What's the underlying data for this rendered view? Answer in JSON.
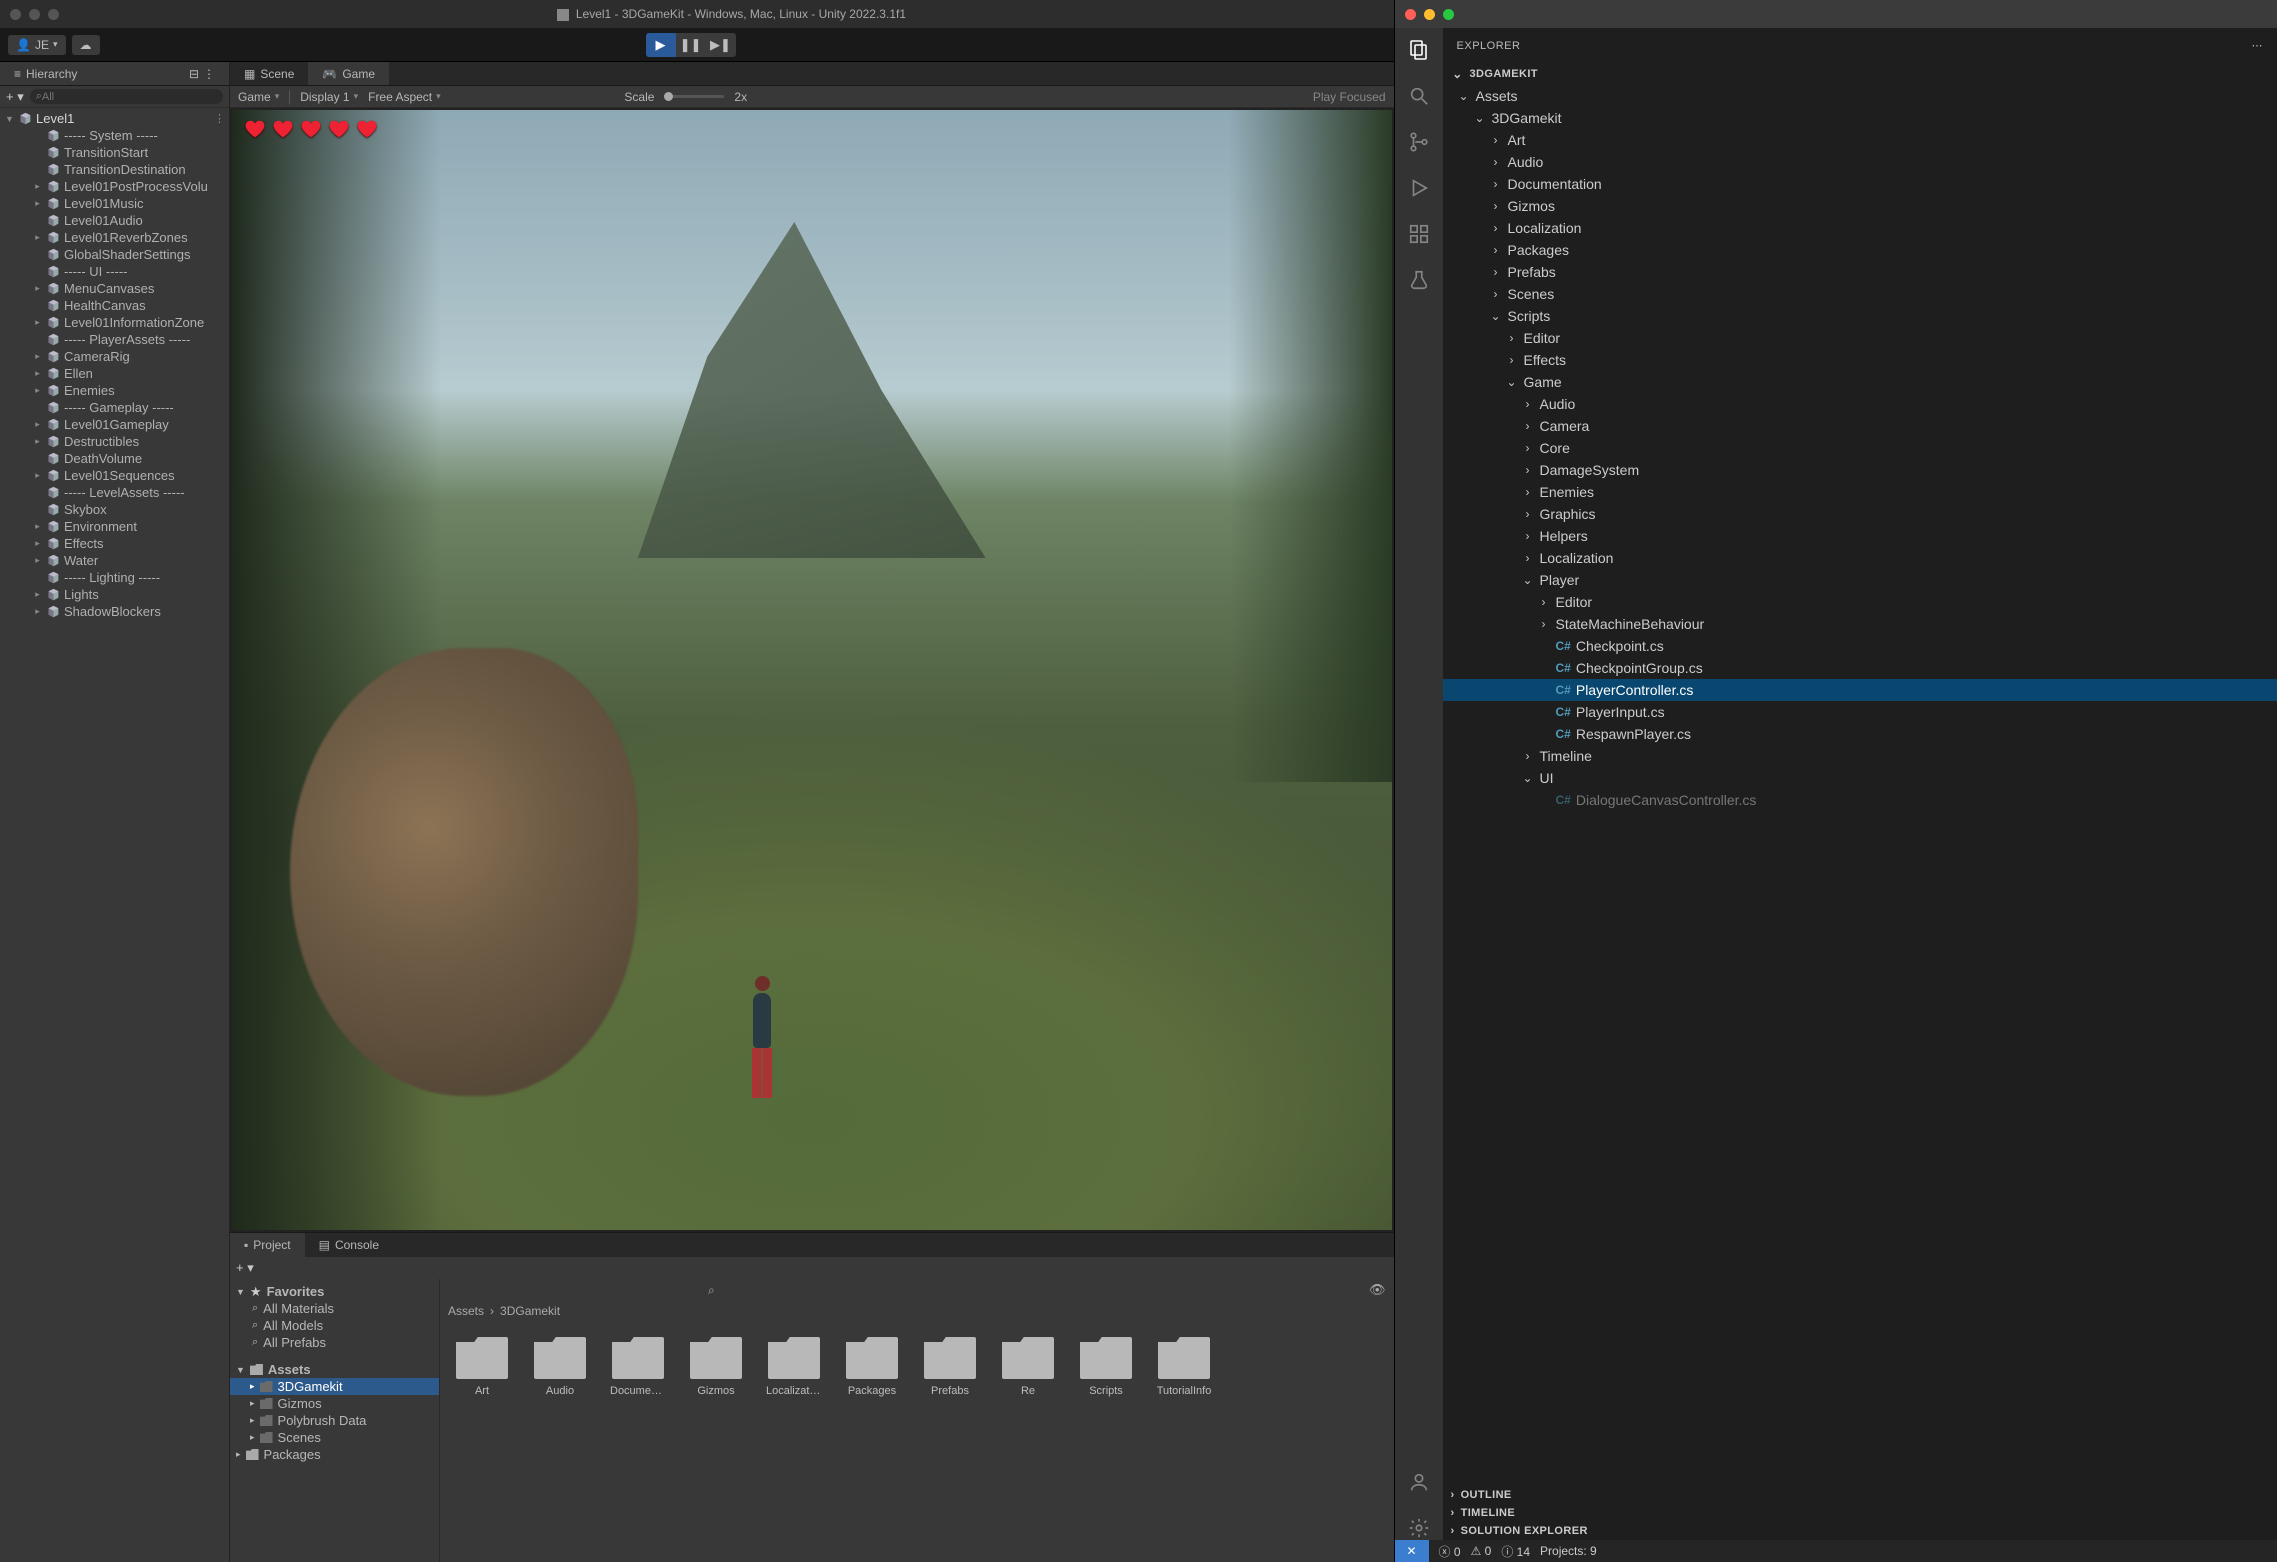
{
  "unity": {
    "title": "Level1 - 3DGameKit - Windows, Mac, Linux - Unity 2022.3.1f1",
    "account_initials": "JE",
    "hierarchy": {
      "tab": "Hierarchy",
      "search_placeholder": "All",
      "root": "Level1",
      "items": [
        {
          "l": "----- System -----",
          "i": 1,
          "e": ""
        },
        {
          "l": "TransitionStart",
          "i": 1,
          "e": ""
        },
        {
          "l": "TransitionDestination",
          "i": 1,
          "e": ""
        },
        {
          "l": "Level01PostProcessVolu",
          "i": 1,
          "e": ">"
        },
        {
          "l": "Level01Music",
          "i": 1,
          "e": ">"
        },
        {
          "l": "Level01Audio",
          "i": 1,
          "e": ""
        },
        {
          "l": "Level01ReverbZones",
          "i": 1,
          "e": ">"
        },
        {
          "l": "GlobalShaderSettings",
          "i": 1,
          "e": ""
        },
        {
          "l": "----- UI -----",
          "i": 1,
          "e": ""
        },
        {
          "l": "MenuCanvases",
          "i": 1,
          "e": ">"
        },
        {
          "l": "HealthCanvas",
          "i": 1,
          "e": ""
        },
        {
          "l": "Level01InformationZone",
          "i": 1,
          "e": ">"
        },
        {
          "l": "----- PlayerAssets -----",
          "i": 1,
          "e": ""
        },
        {
          "l": "CameraRig",
          "i": 1,
          "e": ">"
        },
        {
          "l": "Ellen",
          "i": 1,
          "e": ">"
        },
        {
          "l": "Enemies",
          "i": 1,
          "e": ">"
        },
        {
          "l": "----- Gameplay -----",
          "i": 1,
          "e": ""
        },
        {
          "l": "Level01Gameplay",
          "i": 1,
          "e": ">"
        },
        {
          "l": "Destructibles",
          "i": 1,
          "e": ">"
        },
        {
          "l": "DeathVolume",
          "i": 1,
          "e": ""
        },
        {
          "l": "Level01Sequences",
          "i": 1,
          "e": ">"
        },
        {
          "l": "----- LevelAssets -----",
          "i": 1,
          "e": ""
        },
        {
          "l": "Skybox",
          "i": 1,
          "e": ""
        },
        {
          "l": "Environment",
          "i": 1,
          "e": ">"
        },
        {
          "l": "Effects",
          "i": 1,
          "e": ">"
        },
        {
          "l": "Water",
          "i": 1,
          "e": ">"
        },
        {
          "l": "----- Lighting -----",
          "i": 1,
          "e": ""
        },
        {
          "l": "Lights",
          "i": 1,
          "e": ">"
        },
        {
          "l": "ShadowBlockers",
          "i": 1,
          "e": ">"
        }
      ]
    },
    "scene": {
      "tab_scene": "Scene",
      "tab_game": "Game",
      "drop_camera": "Game",
      "drop_display": "Display 1",
      "drop_aspect": "Free Aspect",
      "scale_label": "Scale",
      "scale_value": "2x",
      "play_focused": "Play Focused",
      "hearts_count": 5
    },
    "project": {
      "tab_project": "Project",
      "tab_console": "Console",
      "favorites_label": "Favorites",
      "fav_items": [
        "All Materials",
        "All Models",
        "All Prefabs"
      ],
      "assets_label": "Assets",
      "assets_tree": [
        "3DGamekit",
        "Gizmos",
        "Polybrush Data",
        "Scenes"
      ],
      "packages_label": "Packages",
      "breadcrumb": [
        "Assets",
        "3DGamekit"
      ],
      "folders": [
        "Art",
        "Audio",
        "Document…",
        "Gizmos",
        "Localization",
        "Packages",
        "Prefabs",
        "Re",
        "Scripts",
        "TutorialInfo"
      ]
    }
  },
  "vscode": {
    "explorer_label": "EXPLORER",
    "root": "3DGAMEKIT",
    "sections": [
      "OUTLINE",
      "TIMELINE",
      "SOLUTION EXPLORER"
    ],
    "status": {
      "errors": "0",
      "warnings": "0",
      "info": "14",
      "projects": "Projects: 9"
    },
    "tree": [
      {
        "d": 0,
        "ch": "v",
        "t": "folder",
        "l": "Assets"
      },
      {
        "d": 1,
        "ch": "v",
        "t": "folder",
        "l": "3DGamekit"
      },
      {
        "d": 2,
        "ch": ">",
        "t": "folder",
        "l": "Art"
      },
      {
        "d": 2,
        "ch": ">",
        "t": "folder",
        "l": "Audio"
      },
      {
        "d": 2,
        "ch": ">",
        "t": "folder",
        "l": "Documentation"
      },
      {
        "d": 2,
        "ch": ">",
        "t": "folder",
        "l": "Gizmos"
      },
      {
        "d": 2,
        "ch": ">",
        "t": "folder",
        "l": "Localization"
      },
      {
        "d": 2,
        "ch": ">",
        "t": "folder",
        "l": "Packages"
      },
      {
        "d": 2,
        "ch": ">",
        "t": "folder",
        "l": "Prefabs"
      },
      {
        "d": 2,
        "ch": ">",
        "t": "folder",
        "l": "Scenes"
      },
      {
        "d": 2,
        "ch": "v",
        "t": "folder",
        "l": "Scripts"
      },
      {
        "d": 3,
        "ch": ">",
        "t": "folder",
        "l": "Editor"
      },
      {
        "d": 3,
        "ch": ">",
        "t": "folder",
        "l": "Effects"
      },
      {
        "d": 3,
        "ch": "v",
        "t": "folder",
        "l": "Game"
      },
      {
        "d": 4,
        "ch": ">",
        "t": "folder",
        "l": "Audio"
      },
      {
        "d": 4,
        "ch": ">",
        "t": "folder",
        "l": "Camera"
      },
      {
        "d": 4,
        "ch": ">",
        "t": "folder",
        "l": "Core"
      },
      {
        "d": 4,
        "ch": ">",
        "t": "folder",
        "l": "DamageSystem"
      },
      {
        "d": 4,
        "ch": ">",
        "t": "folder",
        "l": "Enemies"
      },
      {
        "d": 4,
        "ch": ">",
        "t": "folder",
        "l": "Graphics"
      },
      {
        "d": 4,
        "ch": ">",
        "t": "folder",
        "l": "Helpers"
      },
      {
        "d": 4,
        "ch": ">",
        "t": "folder",
        "l": "Localization"
      },
      {
        "d": 4,
        "ch": "v",
        "t": "folder",
        "l": "Player"
      },
      {
        "d": 5,
        "ch": ">",
        "t": "folder",
        "l": "Editor"
      },
      {
        "d": 5,
        "ch": ">",
        "t": "folder",
        "l": "StateMachineBehaviour"
      },
      {
        "d": 5,
        "ch": "",
        "t": "cs",
        "l": "Checkpoint.cs"
      },
      {
        "d": 5,
        "ch": "",
        "t": "cs",
        "l": "CheckpointGroup.cs"
      },
      {
        "d": 5,
        "ch": "",
        "t": "cs",
        "l": "PlayerController.cs",
        "sel": true
      },
      {
        "d": 5,
        "ch": "",
        "t": "cs",
        "l": "PlayerInput.cs"
      },
      {
        "d": 5,
        "ch": "",
        "t": "cs",
        "l": "RespawnPlayer.cs"
      },
      {
        "d": 4,
        "ch": ">",
        "t": "folder",
        "l": "Timeline"
      },
      {
        "d": 4,
        "ch": "v",
        "t": "folder",
        "l": "UI"
      },
      {
        "d": 5,
        "ch": "",
        "t": "cs",
        "l": "DialogueCanvasController.cs",
        "cut": true
      }
    ]
  }
}
